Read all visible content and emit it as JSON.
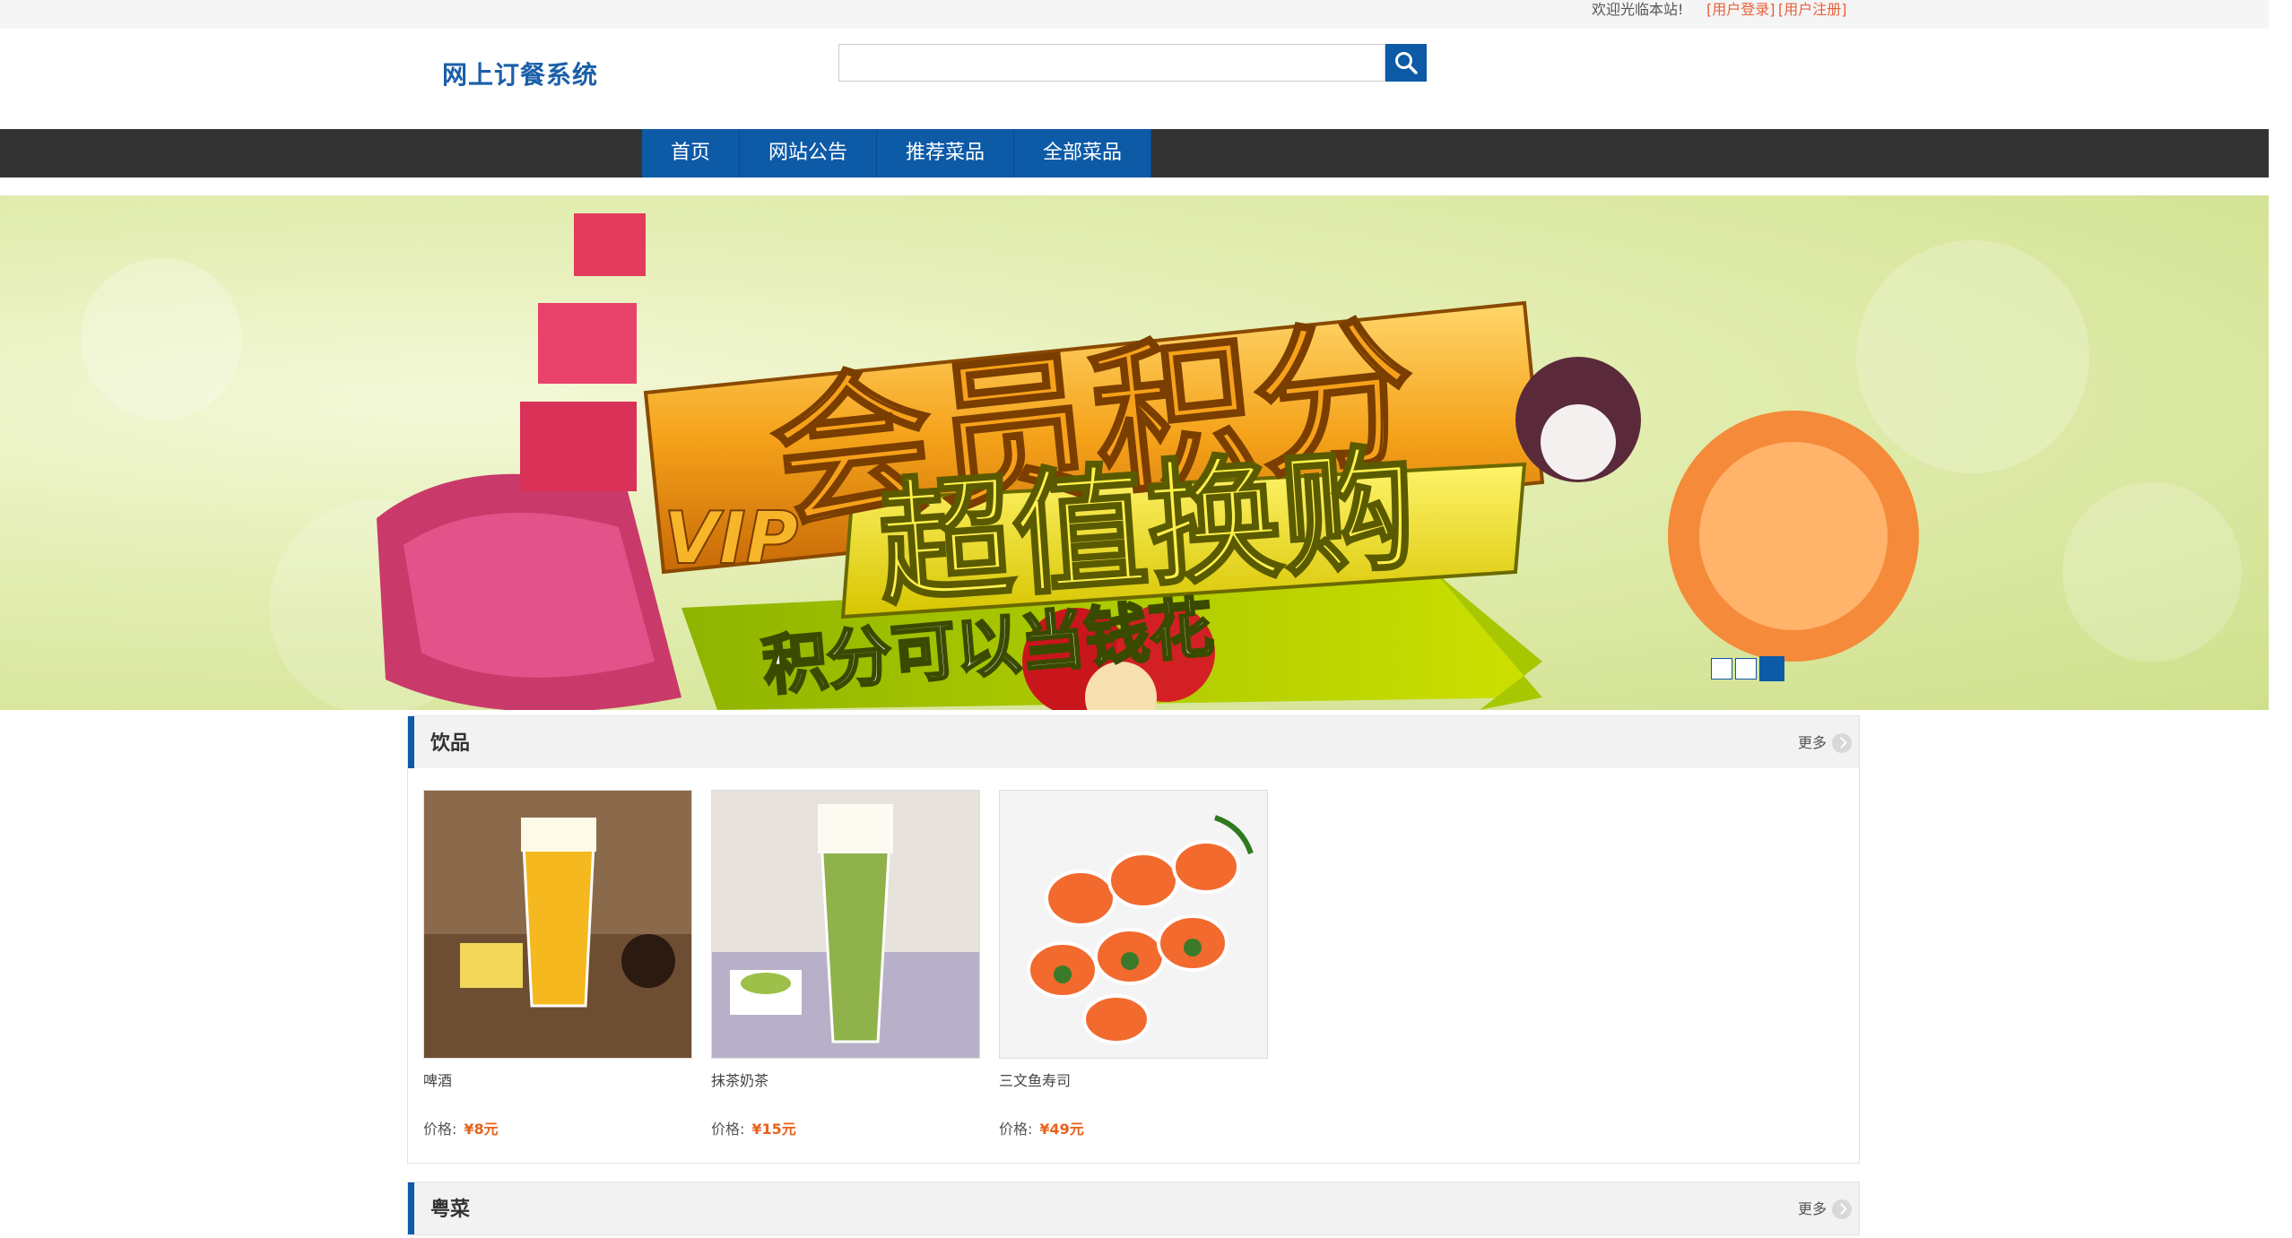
{
  "topbar": {
    "welcome": "欢迎光临本站!",
    "login_link": "[用户登录]",
    "register_link": "[用户注册]"
  },
  "header": {
    "site_title": "网上订餐系统",
    "search": {
      "value": "",
      "placeholder": ""
    },
    "search_icon": "search-icon"
  },
  "nav": {
    "items": [
      {
        "label": "首页"
      },
      {
        "label": "网站公告"
      },
      {
        "label": "推荐菜品"
      },
      {
        "label": "全部菜品"
      }
    ]
  },
  "banner": {
    "headline": "会员积分",
    "subline": "超值换购",
    "vip": "VIP",
    "tagline": "积分可以当钱花",
    "slides": 3,
    "active_slide": 3
  },
  "sections": [
    {
      "title": "饮品",
      "more": "更多",
      "products": [
        {
          "name": "啤酒",
          "price_label": "价格:",
          "price": "¥8元"
        },
        {
          "name": "抹茶奶茶",
          "price_label": "价格:",
          "price": "¥15元"
        },
        {
          "name": "三文鱼寿司",
          "price_label": "价格:",
          "price": "¥49元"
        }
      ]
    },
    {
      "title": "粤菜",
      "more": "更多"
    }
  ],
  "colors": {
    "brand_blue": "#0d5aa7",
    "nav_bg": "#333333",
    "price_orange": "#e8611a",
    "link_orange": "#e8613c"
  }
}
